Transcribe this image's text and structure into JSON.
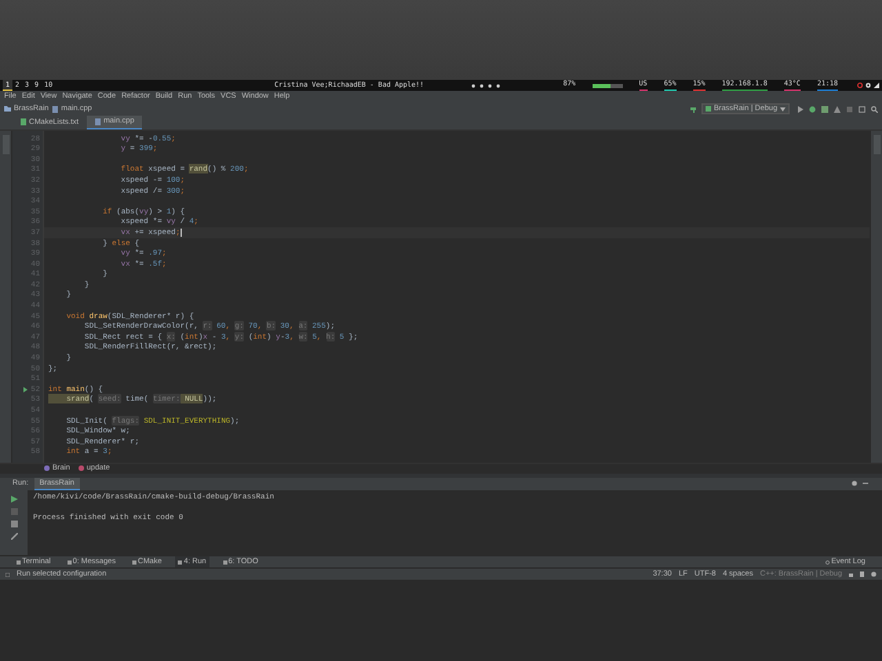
{
  "top_bar": {
    "workspaces": [
      {
        "label": "1",
        "selected": true
      },
      {
        "label": "2",
        "selected": false
      },
      {
        "label": "3",
        "selected": false
      },
      {
        "label": "9",
        "selected": false
      },
      {
        "label": "10",
        "selected": false
      }
    ],
    "title": "Cristina Vee;RichaadEB - Bad Apple!!",
    "indicators": [
      {
        "kind": "text",
        "text": "87%"
      },
      {
        "kind": "meter",
        "level": 0.6
      },
      {
        "kind": "text",
        "text": "US",
        "color": "#d6336c"
      },
      {
        "kind": "text",
        "text": "65%",
        "color": "#20c9b0"
      },
      {
        "kind": "text",
        "text": "15%",
        "color": "#e03131"
      },
      {
        "kind": "text",
        "text": "192.168.1.8",
        "color": "#2f9e44"
      },
      {
        "kind": "text",
        "text": "43°C",
        "color": "#d6336c"
      },
      {
        "kind": "text",
        "text": "21:18",
        "color": "#1c7ed6"
      }
    ]
  },
  "menu": [
    "File",
    "Edit",
    "View",
    "Navigate",
    "Code",
    "Refactor",
    "Build",
    "Run",
    "Tools",
    "VCS",
    "Window",
    "Help"
  ],
  "navigation": {
    "breadcrumb": [
      "BrassRain",
      "main.cpp"
    ],
    "run_configuration": "BrassRain | Debug"
  },
  "tabs": [
    {
      "label": "CMakeLists.txt",
      "selected": false
    },
    {
      "label": "main.cpp",
      "selected": true
    }
  ],
  "editor": {
    "lines": [
      {
        "n": "28",
        "current": false,
        "segs": [
          {
            "text": "                vy",
            "kind": "field"
          },
          {
            "text": " *= -",
            "kind": "plain"
          },
          {
            "text": "0.55",
            "kind": "number"
          },
          {
            "text": ";",
            "kind": "keyword"
          }
        ]
      },
      {
        "n": "29",
        "current": false,
        "segs": [
          {
            "text": "                y",
            "kind": "field"
          },
          {
            "text": " = ",
            "kind": "plain"
          },
          {
            "text": "399",
            "kind": "number"
          },
          {
            "text": ";",
            "kind": "keyword"
          }
        ]
      },
      {
        "n": "30",
        "current": false
      },
      {
        "n": "31",
        "current": false,
        "segs": [
          {
            "text": "                float",
            "kind": "keyword"
          },
          {
            "text": " xspeed = ",
            "kind": "plain"
          },
          {
            "text": "rand",
            "kind": "usage"
          },
          {
            "text": "() % ",
            "kind": "plain"
          },
          {
            "text": "200",
            "kind": "number"
          },
          {
            "text": ";",
            "kind": "keyword"
          }
        ]
      },
      {
        "n": "32",
        "current": false,
        "segs": [
          {
            "text": "                xspeed -= ",
            "kind": "plain"
          },
          {
            "text": "100",
            "kind": "number"
          },
          {
            "text": ";",
            "kind": "keyword"
          }
        ]
      },
      {
        "n": "33",
        "current": false,
        "segs": [
          {
            "text": "                xspeed /= ",
            "kind": "plain"
          },
          {
            "text": "300",
            "kind": "number"
          },
          {
            "text": ";",
            "kind": "keyword"
          }
        ]
      },
      {
        "n": "34",
        "current": false
      },
      {
        "n": "35",
        "current": false,
        "segs": [
          {
            "text": "            if",
            "kind": "keyword"
          },
          {
            "text": " (abs(",
            "kind": "plain"
          },
          {
            "text": "vy",
            "kind": "field"
          },
          {
            "text": ") > ",
            "kind": "plain"
          },
          {
            "text": "1",
            "kind": "number"
          },
          {
            "text": ") {",
            "kind": "plain"
          }
        ]
      },
      {
        "n": "36",
        "current": false,
        "segs": [
          {
            "text": "                xspeed *= ",
            "kind": "plain"
          },
          {
            "text": "vy",
            "kind": "field"
          },
          {
            "text": " / ",
            "kind": "plain"
          },
          {
            "text": "4",
            "kind": "number"
          },
          {
            "text": ";",
            "kind": "keyword"
          }
        ]
      },
      {
        "n": "37",
        "current": true,
        "segs": [
          {
            "text": "                vx",
            "kind": "field"
          },
          {
            "text": " += xspeed",
            "kind": "plain"
          },
          {
            "text": ";",
            "kind": "keyword"
          }
        ]
      },
      {
        "n": "38",
        "current": false,
        "segs": [
          {
            "text": "            } ",
            "kind": "plain"
          },
          {
            "text": "else",
            "kind": "keyword"
          },
          {
            "text": " {",
            "kind": "plain"
          }
        ]
      },
      {
        "n": "39",
        "current": false,
        "segs": [
          {
            "text": "                vy",
            "kind": "field"
          },
          {
            "text": " *= ",
            "kind": "plain"
          },
          {
            "text": ".97",
            "kind": "number"
          },
          {
            "text": ";",
            "kind": "keyword"
          }
        ]
      },
      {
        "n": "40",
        "current": false,
        "segs": [
          {
            "text": "                vx",
            "kind": "field"
          },
          {
            "text": " *= ",
            "kind": "plain"
          },
          {
            "text": ".5f",
            "kind": "number"
          },
          {
            "text": ";",
            "kind": "keyword"
          }
        ]
      },
      {
        "n": "41",
        "current": false,
        "segs": [
          {
            "text": "            }",
            "kind": "plain"
          }
        ]
      },
      {
        "n": "42",
        "current": false,
        "segs": [
          {
            "text": "        }",
            "kind": "plain"
          }
        ]
      },
      {
        "n": "43",
        "current": false,
        "segs": [
          {
            "text": "    }",
            "kind": "plain"
          }
        ]
      },
      {
        "n": "44",
        "current": false
      },
      {
        "n": "45",
        "current": false,
        "segs": [
          {
            "text": "    void ",
            "kind": "keyword"
          },
          {
            "text": "draw",
            "kind": "function"
          },
          {
            "text": "(SDL_Renderer* r) {",
            "kind": "plain"
          }
        ]
      },
      {
        "n": "46",
        "current": false,
        "segs": [
          {
            "text": "        SDL_SetRenderDrawColor(r, ",
            "kind": "plain"
          },
          {
            "text": "r:",
            "kind": "hint"
          },
          {
            "text": " 60",
            "kind": "number"
          },
          {
            "text": ", ",
            "kind": "keyword"
          },
          {
            "text": "g:",
            "kind": "hint"
          },
          {
            "text": " 70",
            "kind": "number"
          },
          {
            "text": ", ",
            "kind": "keyword"
          },
          {
            "text": "b:",
            "kind": "hint"
          },
          {
            "text": " 30",
            "kind": "number"
          },
          {
            "text": ", ",
            "kind": "keyword"
          },
          {
            "text": "a:",
            "kind": "hint"
          },
          {
            "text": " 255",
            "kind": "number"
          },
          {
            "text": ");",
            "kind": "plain"
          }
        ]
      },
      {
        "n": "47",
        "current": false,
        "segs": [
          {
            "text": "        SDL_Rect rect = { ",
            "kind": "plain"
          },
          {
            "text": "x:",
            "kind": "hint"
          },
          {
            "text": " (",
            "kind": "plain"
          },
          {
            "text": "int",
            "kind": "keyword"
          },
          {
            "text": ")",
            "kind": "plain"
          },
          {
            "text": "x",
            "kind": "field"
          },
          {
            "text": " - ",
            "kind": "plain"
          },
          {
            "text": "3",
            "kind": "number"
          },
          {
            "text": ", ",
            "kind": "keyword"
          },
          {
            "text": "y:",
            "kind": "hint"
          },
          {
            "text": " (",
            "kind": "plain"
          },
          {
            "text": "int",
            "kind": "keyword"
          },
          {
            "text": ") ",
            "kind": "plain"
          },
          {
            "text": "y",
            "kind": "field"
          },
          {
            "text": "-",
            "kind": "plain"
          },
          {
            "text": "3",
            "kind": "number"
          },
          {
            "text": ", ",
            "kind": "keyword"
          },
          {
            "text": "w:",
            "kind": "hint"
          },
          {
            "text": " 5",
            "kind": "number"
          },
          {
            "text": ", ",
            "kind": "keyword"
          },
          {
            "text": "h:",
            "kind": "hint"
          },
          {
            "text": " 5",
            "kind": "number"
          },
          {
            "text": " };",
            "kind": "plain"
          }
        ]
      },
      {
        "n": "48",
        "current": false,
        "segs": [
          {
            "text": "        SDL_RenderFillRect(r, &rect);",
            "kind": "plain"
          }
        ]
      },
      {
        "n": "49",
        "current": false,
        "segs": [
          {
            "text": "    }",
            "kind": "plain"
          }
        ]
      },
      {
        "n": "50",
        "current": false,
        "segs": [
          {
            "text": "};",
            "kind": "plain"
          }
        ]
      },
      {
        "n": "51",
        "current": false
      },
      {
        "n": "52",
        "current": false,
        "gutter": {
          "kind": "run"
        },
        "segs": [
          {
            "text": "int ",
            "kind": "keyword"
          },
          {
            "text": "main",
            "kind": "function"
          },
          {
            "text": "() {",
            "kind": "plain"
          }
        ]
      },
      {
        "n": "53",
        "current": false,
        "segs": [
          {
            "text": "    srand",
            "kind": "usage"
          },
          {
            "text": "( ",
            "kind": "plain"
          },
          {
            "text": "seed:",
            "kind": "hint"
          },
          {
            "text": " time( ",
            "kind": "plain"
          },
          {
            "text": "timer:",
            "kind": "hint"
          },
          {
            "text": " NULL",
            "kind": "usage"
          },
          {
            "text": "));",
            "kind": "plain"
          }
        ]
      },
      {
        "n": "54",
        "current": false
      },
      {
        "n": "55",
        "current": false,
        "segs": [
          {
            "text": "    SDL_Init( ",
            "kind": "plain"
          },
          {
            "text": "flags:",
            "kind": "hint"
          },
          {
            "text": " SDL_INIT_EVERYTHING",
            "kind": "macro"
          },
          {
            "text": ");",
            "kind": "plain"
          }
        ]
      },
      {
        "n": "56",
        "current": false,
        "segs": [
          {
            "text": "    SDL_Window* w;",
            "kind": "plain"
          }
        ]
      },
      {
        "n": "57",
        "current": false,
        "segs": [
          {
            "text": "    SDL_Renderer* r;",
            "kind": "plain"
          }
        ]
      },
      {
        "n": "58",
        "current": false,
        "segs": [
          {
            "text": "    int",
            "kind": "keyword"
          },
          {
            "text": " a = ",
            "kind": "plain"
          },
          {
            "text": "3",
            "kind": "number"
          },
          {
            "text": ";",
            "kind": "keyword"
          }
        ]
      }
    ],
    "breadcrumb": [
      "Brain",
      "update"
    ]
  },
  "run_panel": {
    "label": "Run:",
    "tab": "BrassRain",
    "output": [
      "/home/kivi/code/BrassRain/cmake-build-debug/BrassRain",
      "Process finished with exit code 0"
    ]
  },
  "tool_tabs": [
    {
      "label": "Terminal",
      "selected": false
    },
    {
      "label": "0: Messages",
      "selected": false
    },
    {
      "label": "CMake",
      "selected": false
    },
    {
      "label": "4: Run",
      "selected": true
    },
    {
      "label": "6: TODO",
      "selected": false
    }
  ],
  "event_log": "Event Log",
  "status_bar": {
    "message": "Run selected configuration",
    "items": [
      "37:30",
      "LF",
      "UTF-8",
      "4 spaces",
      "C++: BrassRain | Debug"
    ]
  }
}
